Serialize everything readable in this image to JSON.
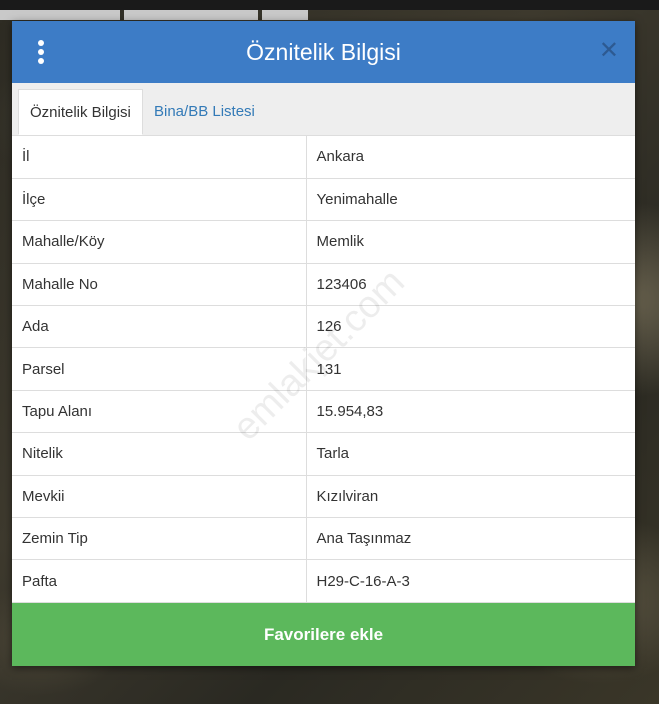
{
  "header": {
    "title": "Öznitelik Bilgisi",
    "close_icon": "close-icon",
    "menu_icon": "kebab-menu-icon"
  },
  "tabs": [
    {
      "label": "Öznitelik Bilgisi",
      "active": true
    },
    {
      "label": "Bina/BB Listesi",
      "active": false
    }
  ],
  "rows": [
    {
      "key": "İl",
      "value": "Ankara"
    },
    {
      "key": "İlçe",
      "value": "Yenimahalle"
    },
    {
      "key": "Mahalle/Köy",
      "value": "Memlik"
    },
    {
      "key": "Mahalle No",
      "value": "123406"
    },
    {
      "key": "Ada",
      "value": "126"
    },
    {
      "key": "Parsel",
      "value": "131"
    },
    {
      "key": "Tapu Alanı",
      "value": "15.954,83"
    },
    {
      "key": "Nitelik",
      "value": "Tarla"
    },
    {
      "key": "Mevkii",
      "value": "Kızılviran"
    },
    {
      "key": "Zemin Tip",
      "value": "Ana Taşınmaz"
    },
    {
      "key": "Pafta",
      "value": "H29-C-16-A-3"
    }
  ],
  "footer": {
    "button_label": "Favorilere ekle"
  },
  "watermark": "emlakjet.com",
  "colors": {
    "header": "#3d7cc6",
    "button": "#5cb85c",
    "tab_link": "#337ab7"
  }
}
